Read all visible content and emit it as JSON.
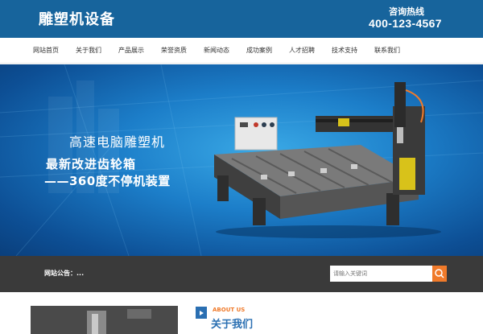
{
  "header": {
    "logo_text": "雕塑机设备",
    "hotline_label": "咨询热线",
    "hotline_number": "400-123-4567"
  },
  "nav": {
    "items": [
      {
        "label": "网站首页"
      },
      {
        "label": "关于我们"
      },
      {
        "label": "产品展示"
      },
      {
        "label": "荣誉资质"
      },
      {
        "label": "新闻动态"
      },
      {
        "label": "成功案例"
      },
      {
        "label": "人才招聘"
      },
      {
        "label": "技术支持"
      },
      {
        "label": "联系我们"
      }
    ]
  },
  "banner": {
    "title": "高速电脑雕塑机",
    "line1": "最新改进齿轮箱",
    "line2": "——360度不停机装置",
    "image_icon": "cnc-engraving-machine"
  },
  "notice": {
    "label": "网站公告：...",
    "search_placeholder": "请输入关键词",
    "search_icon": "search-icon"
  },
  "about": {
    "title_en": "ABOUT US",
    "title_cn": "关于我们"
  },
  "colors": {
    "header_bg": "#17649c",
    "notice_bg": "#3a3a3a",
    "accent_orange": "#f07a2a",
    "accent_blue": "#2a6fb2"
  }
}
